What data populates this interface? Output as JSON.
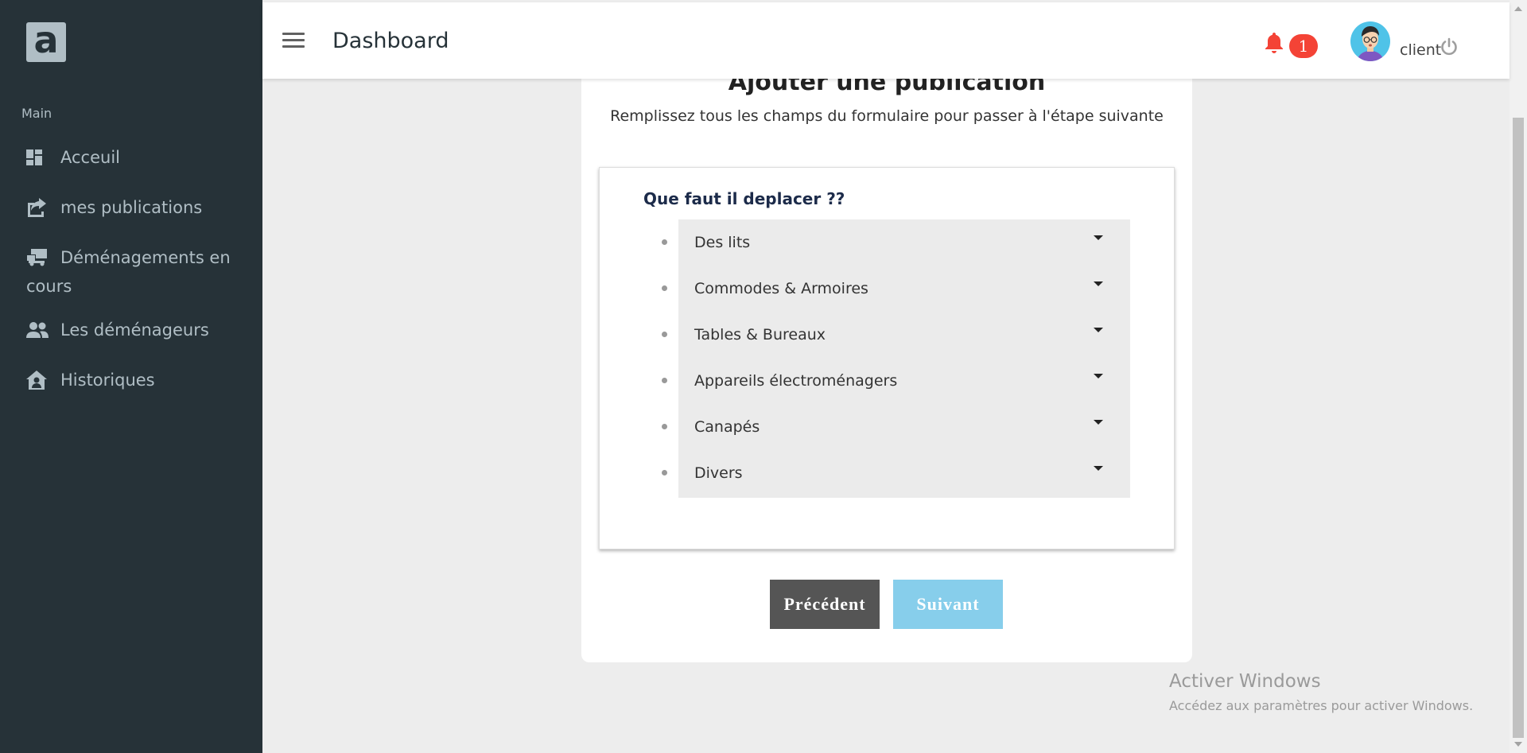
{
  "sidebar": {
    "logo_letter": "a",
    "section_label": "Main",
    "items": [
      {
        "label": "Acceuil",
        "icon": "dashboard-icon"
      },
      {
        "label": "mes publications",
        "icon": "share-icon"
      },
      {
        "label": "Déménagements en cours",
        "icon": "truck-icon"
      },
      {
        "label": "Les déménageurs",
        "icon": "people-icon"
      },
      {
        "label": "Historiques",
        "icon": "house-user-icon"
      }
    ]
  },
  "header": {
    "title": "Dashboard",
    "notification_count": "1",
    "user_name": "client"
  },
  "form": {
    "title": "Ajouter une publication",
    "subtitle": "Remplissez tous les champs du formulaire pour passer à l'étape suivante",
    "question": "Que faut il deplacer ??",
    "options": [
      "Des lits",
      "Commodes & Armoires",
      "Tables & Bureaux",
      "Appareils électroménagers",
      "Canapés",
      "Divers"
    ],
    "prev_label": "Précédent",
    "next_label": "Suivant"
  },
  "watermark": {
    "line1": "Activer Windows",
    "line2": "Accédez aux paramètres pour activer Windows."
  },
  "colors": {
    "sidebar_bg": "#263238",
    "badge": "#f44336",
    "bell": "#f44336",
    "prev_button": "#555555",
    "next_button": "#87ceeb"
  }
}
